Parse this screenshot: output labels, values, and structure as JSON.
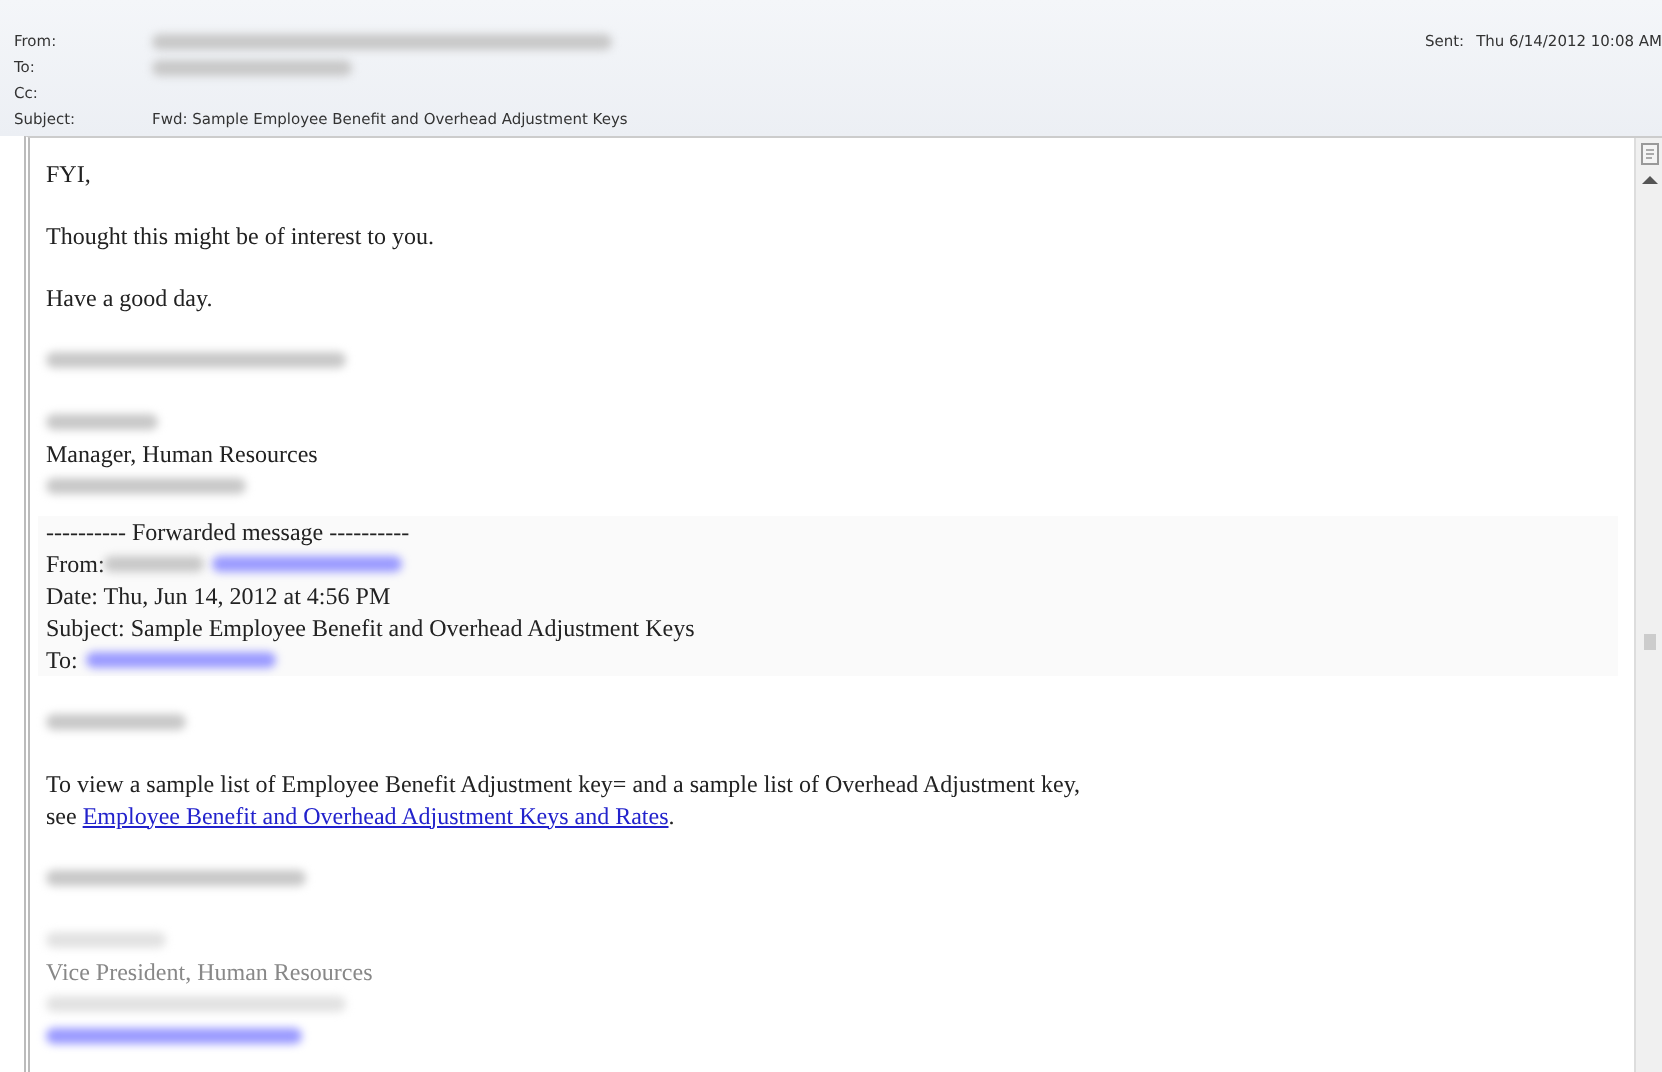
{
  "header": {
    "fields": [
      {
        "label": "From:",
        "kind": "blurred"
      },
      {
        "label": "To:",
        "kind": "blurred"
      },
      {
        "label": "Cc:",
        "kind": "empty"
      },
      {
        "label": "Subject:",
        "kind": "text",
        "value": "Fwd: Sample Employee Benefit and Overhead Adjustment Keys"
      }
    ],
    "sent_label": "Sent:",
    "sent_value": "Thu 6/14/2012 10:08 AM"
  },
  "body": [
    {
      "kind": "plain",
      "lines": [
        {
          "kind": "text",
          "segments": [
            {
              "text": "FYI,"
            }
          ]
        }
      ]
    },
    {
      "kind": "plain",
      "lines": [
        {
          "kind": "text",
          "segments": [
            {
              "text": "Thought this might be of interest to you."
            }
          ]
        }
      ]
    },
    {
      "kind": "plain",
      "lines": [
        {
          "kind": "text",
          "segments": [
            {
              "text": "Have a good day."
            }
          ]
        }
      ]
    },
    {
      "kind": "plain",
      "lines": [
        {
          "kind": "blurred"
        }
      ]
    },
    {
      "kind": "plain",
      "lines": [
        {
          "kind": "blurred"
        },
        {
          "kind": "text",
          "segments": [
            {
              "text": "Manager, Human Resources"
            }
          ]
        },
        {
          "kind": "blurred"
        }
      ]
    },
    {
      "kind": "forwarded",
      "lines": [
        {
          "kind": "text",
          "segments": [
            {
              "text": "---------- Forwarded message ----------"
            }
          ]
        },
        {
          "kind": "name_and_email",
          "segments": [
            {
              "text": "From: "
            }
          ]
        },
        {
          "kind": "text",
          "segments": [
            {
              "text": "Date: Thu, Jun 14, 2012 at 4:56 PM"
            }
          ]
        },
        {
          "kind": "text",
          "segments": [
            {
              "text": "Subject: Sample Employee Benefit and Overhead Adjustment Keys"
            }
          ]
        },
        {
          "kind": "email",
          "segments": [
            {
              "text": "To: "
            }
          ]
        }
      ]
    },
    {
      "kind": "plain",
      "lines": [
        {
          "kind": "blurred"
        }
      ]
    },
    {
      "kind": "plain",
      "lines": [
        {
          "kind": "text",
          "segments": [
            {
              "text": "To view a sample list of Employee Benefit Adjustment key= and a sample list of Overhead Adjustment key,"
            }
          ]
        },
        {
          "kind": "text",
          "segments": [
            {
              "kind": "plain",
              "text": "see "
            },
            {
              "kind": "link",
              "text": "Employee Benefit and Overhead Adjustment Keys and Rates"
            },
            {
              "kind": "plain",
              "text": "."
            }
          ]
        }
      ]
    },
    {
      "kind": "plain",
      "lines": [
        {
          "kind": "blurred"
        }
      ]
    },
    {
      "kind": "plain",
      "lines": [
        {
          "kind": "blurred",
          "muted": true
        },
        {
          "kind": "text",
          "muted": true,
          "segments": [
            {
              "text": "Vice President, Human Resources"
            }
          ]
        },
        {
          "kind": "blurred",
          "muted": true
        },
        {
          "kind": "blurred_link"
        }
      ]
    }
  ]
}
